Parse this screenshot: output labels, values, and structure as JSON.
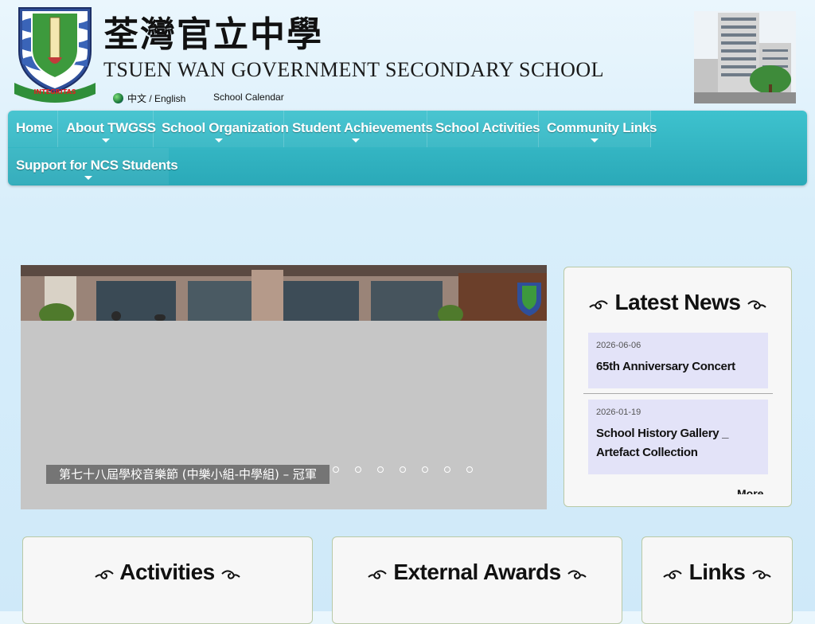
{
  "header": {
    "title_zh": "荃灣官立中學",
    "title_en": "TSUEN WAN GOVERNMENT SECONDARY SCHOOL",
    "lang_link": "中文 / English",
    "calendar_link": "School Calendar",
    "logo_motto": "INTEGRITAS"
  },
  "nav": {
    "items": [
      {
        "label": "Home",
        "has_submenu": false
      },
      {
        "label": "About TWGSS",
        "has_submenu": true
      },
      {
        "label": "School Organization",
        "has_submenu": true
      },
      {
        "label": "Student Achievements",
        "has_submenu": true
      },
      {
        "label": "School Activities",
        "has_submenu": false
      },
      {
        "label": "Community Links",
        "has_submenu": true
      },
      {
        "label": "Support for NCS Students",
        "has_submenu": true
      }
    ]
  },
  "slider": {
    "caption": "第七十八屆學校音樂節 (中樂小組-中學組) – 冠軍",
    "dot_count": 7
  },
  "news": {
    "title": "Latest News",
    "items": [
      {
        "date": "2026-06-06",
        "text": "65th Anniversary Concert"
      },
      {
        "date": "2026-01-19",
        "text": "School History Gallery _ Artefact Collection"
      }
    ],
    "more_label": "More"
  },
  "panels": {
    "activities": "Activities",
    "awards": "External Awards",
    "links": "Links"
  },
  "colors": {
    "nav_bg": "#2fb3c1",
    "news_card_bg": "#e3e3f8",
    "page_bg": "#d8eefa"
  }
}
